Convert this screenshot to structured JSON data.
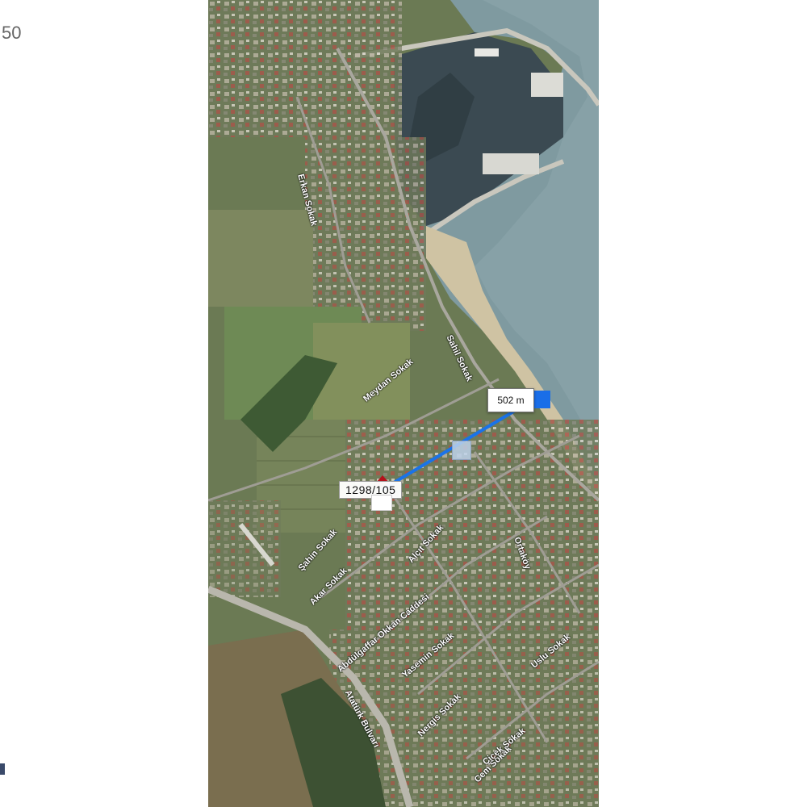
{
  "page": {
    "number_fragment": "50"
  },
  "map": {
    "parcel_label": "1298/105",
    "distance_label": "502 m",
    "street_labels": [
      "Şahin Sokak",
      "Atatürk Bulvarı",
      "Akar Sokak",
      "Alçıt Sokak",
      "Abdülgaffar Okkan Caddesi",
      "Yasemin Sokak",
      "Nergis Sokak",
      "Cem Sokak",
      "Sahil Sokak",
      "Erkan Sokak",
      "Çiçek Sokak",
      "Meydan Sokak",
      "Uslu Sokak",
      "Ortaköy"
    ]
  },
  "colors": {
    "sea": "#7f9aa0",
    "harbor_water": "#3b4a52",
    "land": "#6b7a54",
    "route": "#1a73e8",
    "pin_roof": "#b4121c"
  },
  "icons": [
    "map-pin-icon",
    "measure-handle-icon",
    "measure-end-icon"
  ]
}
